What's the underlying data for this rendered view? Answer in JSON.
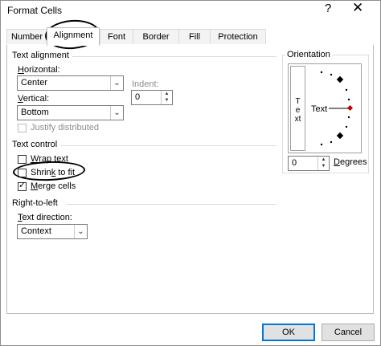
{
  "window": {
    "title": "Format Cells",
    "help_glyph": "?",
    "close_glyph": "✕"
  },
  "tabs": [
    {
      "label": "Number"
    },
    {
      "label": "Alignment",
      "active": true
    },
    {
      "label": "Font"
    },
    {
      "label": "Border"
    },
    {
      "label": "Fill"
    },
    {
      "label": "Protection"
    }
  ],
  "text_alignment": {
    "group_label": "Text alignment",
    "horizontal_label": "Horizontal:",
    "horizontal_value": "Center",
    "vertical_label": "Vertical:",
    "vertical_value": "Bottom",
    "indent_label": "Indent:",
    "indent_value": "0",
    "justify_label": "Justify distributed",
    "justify_checked": false,
    "justify_enabled": false
  },
  "text_control": {
    "group_label": "Text control",
    "wrap_label": "Wrap text",
    "wrap_checked": false,
    "shrink_label": "Shrink to fit",
    "shrink_checked": false,
    "merge_label": "Merge cells",
    "merge_checked": true
  },
  "rtl": {
    "group_label": "Right-to-left",
    "direction_label": "Text direction:",
    "direction_value": "Context"
  },
  "orientation": {
    "group_label": "Orientation",
    "vertical_text": "Text",
    "horizontal_text": "Text",
    "degrees_value": "0",
    "degrees_label": "Degrees"
  },
  "buttons": {
    "ok": "OK",
    "cancel": "Cancel"
  },
  "icons": {
    "dropdown": "chevron-down-icon",
    "spin_up": "▲",
    "spin_down": "▼",
    "check": "✓"
  },
  "colors": {
    "accent_border": "#0078d7",
    "orientation_marker": "#c00000",
    "annotation_ink": "#000000"
  }
}
